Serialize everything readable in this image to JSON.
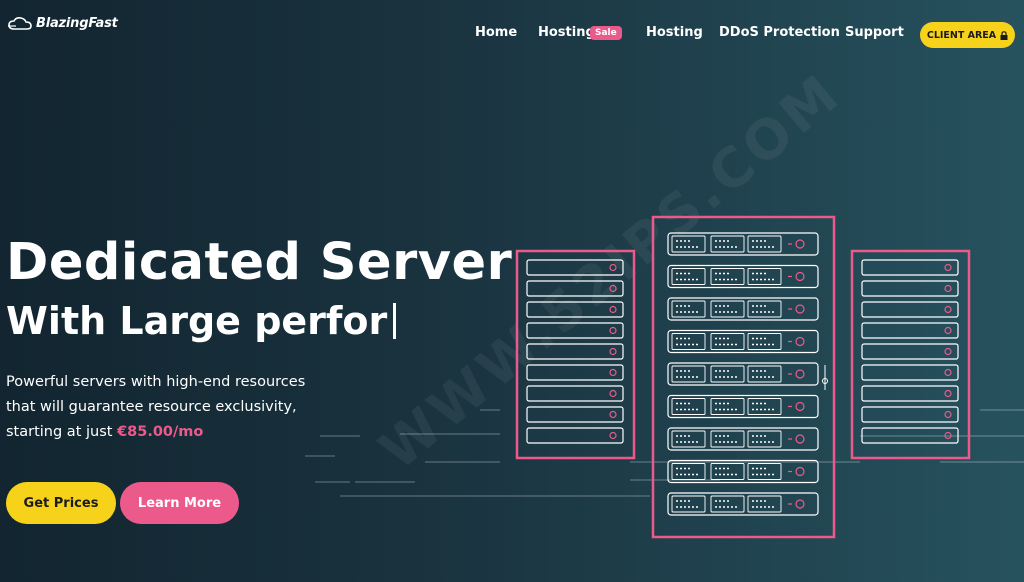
{
  "brand": {
    "name": "BlazingFast"
  },
  "nav": {
    "items": [
      {
        "label": "Home"
      },
      {
        "label": "Hosting",
        "badge": "Sale"
      },
      {
        "label": "Hosting"
      },
      {
        "label": "DDoS Protection"
      },
      {
        "label": "Support"
      }
    ],
    "client_area": "CLIENT AREA",
    "client_area_icon": "lock-icon"
  },
  "hero": {
    "title": "Dedicated Server",
    "subtitle": "With Large perfor",
    "desc_line1": "Powerful servers with high-end resources",
    "desc_line2": "that will guarantee resource exclusivity,",
    "desc_line3_prefix": "starting at just ",
    "price": "€85.00/mo",
    "btn_prices": "Get Prices",
    "btn_learn": "Learn More"
  },
  "watermark": "WWW.52IPS.COM",
  "colors": {
    "accent_yellow": "#f7d21b",
    "accent_pink": "#ec5a8c"
  }
}
